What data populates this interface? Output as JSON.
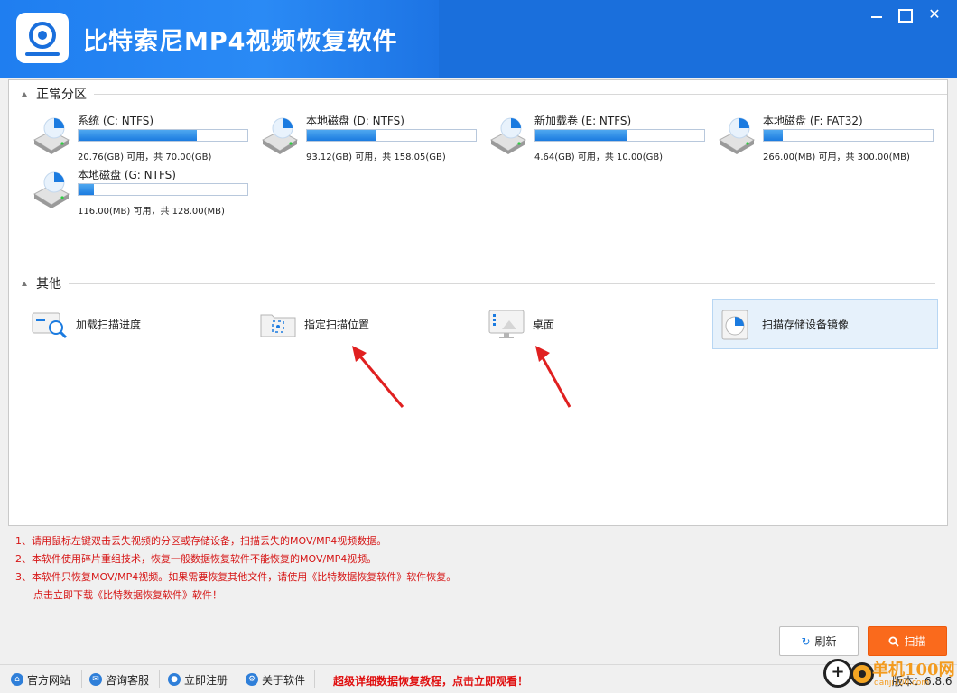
{
  "app": {
    "title": "比特索尼MP4视频恢复软件"
  },
  "sections": {
    "partitions": "正常分区",
    "other": "其他"
  },
  "disks": [
    {
      "name": "系统 (C: NTFS)",
      "usage": "20.76(GB) 可用，共 70.00(GB)",
      "used_percent": 70
    },
    {
      "name": "本地磁盘 (D: NTFS)",
      "usage": "93.12(GB) 可用，共 158.05(GB)",
      "used_percent": 41
    },
    {
      "name": "新加载卷 (E: NTFS)",
      "usage": "4.64(GB) 可用，共 10.00(GB)",
      "used_percent": 54
    },
    {
      "name": "本地磁盘 (F: FAT32)",
      "usage": "266.00(MB) 可用，共 300.00(MB)",
      "used_percent": 11
    },
    {
      "name": "本地磁盘 (G: NTFS)",
      "usage": "116.00(MB) 可用，共 128.00(MB)",
      "used_percent": 9
    }
  ],
  "other_items": [
    {
      "label": "加载扫描进度",
      "icon": "load-progress-icon"
    },
    {
      "label": "指定扫描位置",
      "icon": "folder-scan-icon"
    },
    {
      "label": "桌面",
      "icon": "desktop-icon"
    },
    {
      "label": "扫描存储设备镜像",
      "icon": "disk-image-icon"
    }
  ],
  "notes": [
    "1、请用鼠标左键双击丢失视频的分区或存储设备，扫描丢失的MOV/MP4视频数据。",
    "2、本软件使用碎片重组技术，恢复一般数据恢复软件不能恢复的MOV/MP4视频。",
    "3、本软件只恢复MOV/MP4视频。如果需要恢复其他文件，请使用《比特数据恢复软件》软件恢复。",
    "点击立即下载《比特数据恢复软件》软件！"
  ],
  "buttons": {
    "refresh": "刷新",
    "scan": "扫描"
  },
  "statusbar": {
    "website": "官方网站",
    "support": "咨询客服",
    "register": "立即注册",
    "about": "关于软件",
    "tutorial_link": "超级详细数据恢复教程，点击立即观看！",
    "version": "版本：6.8.6"
  },
  "watermark": {
    "text": "单机100网",
    "sub": "danji100.com"
  },
  "colors": {
    "titlebar": "#1a6fdc",
    "accent": "#1b7be0",
    "scan_button": "#fa6a1c",
    "note_text": "#d61515"
  }
}
